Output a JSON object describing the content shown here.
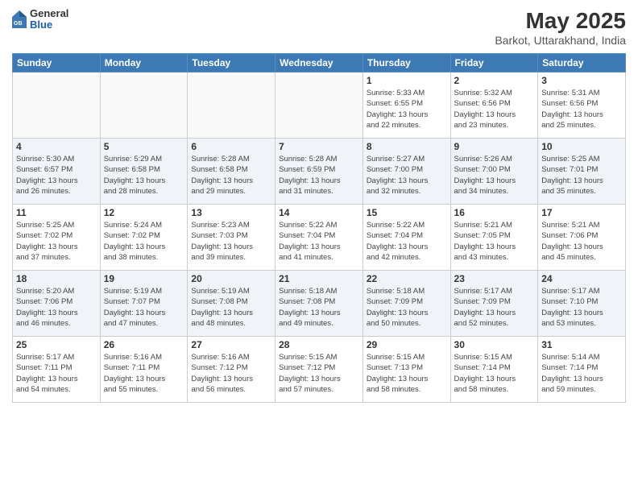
{
  "logo": {
    "general": "General",
    "blue": "Blue"
  },
  "header": {
    "title": "May 2025",
    "location": "Barkot, Uttarakhand, India"
  },
  "days": [
    "Sunday",
    "Monday",
    "Tuesday",
    "Wednesday",
    "Thursday",
    "Friday",
    "Saturday"
  ],
  "weeks": [
    [
      {
        "day": "",
        "info": ""
      },
      {
        "day": "",
        "info": ""
      },
      {
        "day": "",
        "info": ""
      },
      {
        "day": "",
        "info": ""
      },
      {
        "day": "1",
        "info": "Sunrise: 5:33 AM\nSunset: 6:55 PM\nDaylight: 13 hours\nand 22 minutes."
      },
      {
        "day": "2",
        "info": "Sunrise: 5:32 AM\nSunset: 6:56 PM\nDaylight: 13 hours\nand 23 minutes."
      },
      {
        "day": "3",
        "info": "Sunrise: 5:31 AM\nSunset: 6:56 PM\nDaylight: 13 hours\nand 25 minutes."
      }
    ],
    [
      {
        "day": "4",
        "info": "Sunrise: 5:30 AM\nSunset: 6:57 PM\nDaylight: 13 hours\nand 26 minutes."
      },
      {
        "day": "5",
        "info": "Sunrise: 5:29 AM\nSunset: 6:58 PM\nDaylight: 13 hours\nand 28 minutes."
      },
      {
        "day": "6",
        "info": "Sunrise: 5:28 AM\nSunset: 6:58 PM\nDaylight: 13 hours\nand 29 minutes."
      },
      {
        "day": "7",
        "info": "Sunrise: 5:28 AM\nSunset: 6:59 PM\nDaylight: 13 hours\nand 31 minutes."
      },
      {
        "day": "8",
        "info": "Sunrise: 5:27 AM\nSunset: 7:00 PM\nDaylight: 13 hours\nand 32 minutes."
      },
      {
        "day": "9",
        "info": "Sunrise: 5:26 AM\nSunset: 7:00 PM\nDaylight: 13 hours\nand 34 minutes."
      },
      {
        "day": "10",
        "info": "Sunrise: 5:25 AM\nSunset: 7:01 PM\nDaylight: 13 hours\nand 35 minutes."
      }
    ],
    [
      {
        "day": "11",
        "info": "Sunrise: 5:25 AM\nSunset: 7:02 PM\nDaylight: 13 hours\nand 37 minutes."
      },
      {
        "day": "12",
        "info": "Sunrise: 5:24 AM\nSunset: 7:02 PM\nDaylight: 13 hours\nand 38 minutes."
      },
      {
        "day": "13",
        "info": "Sunrise: 5:23 AM\nSunset: 7:03 PM\nDaylight: 13 hours\nand 39 minutes."
      },
      {
        "day": "14",
        "info": "Sunrise: 5:22 AM\nSunset: 7:04 PM\nDaylight: 13 hours\nand 41 minutes."
      },
      {
        "day": "15",
        "info": "Sunrise: 5:22 AM\nSunset: 7:04 PM\nDaylight: 13 hours\nand 42 minutes."
      },
      {
        "day": "16",
        "info": "Sunrise: 5:21 AM\nSunset: 7:05 PM\nDaylight: 13 hours\nand 43 minutes."
      },
      {
        "day": "17",
        "info": "Sunrise: 5:21 AM\nSunset: 7:06 PM\nDaylight: 13 hours\nand 45 minutes."
      }
    ],
    [
      {
        "day": "18",
        "info": "Sunrise: 5:20 AM\nSunset: 7:06 PM\nDaylight: 13 hours\nand 46 minutes."
      },
      {
        "day": "19",
        "info": "Sunrise: 5:19 AM\nSunset: 7:07 PM\nDaylight: 13 hours\nand 47 minutes."
      },
      {
        "day": "20",
        "info": "Sunrise: 5:19 AM\nSunset: 7:08 PM\nDaylight: 13 hours\nand 48 minutes."
      },
      {
        "day": "21",
        "info": "Sunrise: 5:18 AM\nSunset: 7:08 PM\nDaylight: 13 hours\nand 49 minutes."
      },
      {
        "day": "22",
        "info": "Sunrise: 5:18 AM\nSunset: 7:09 PM\nDaylight: 13 hours\nand 50 minutes."
      },
      {
        "day": "23",
        "info": "Sunrise: 5:17 AM\nSunset: 7:09 PM\nDaylight: 13 hours\nand 52 minutes."
      },
      {
        "day": "24",
        "info": "Sunrise: 5:17 AM\nSunset: 7:10 PM\nDaylight: 13 hours\nand 53 minutes."
      }
    ],
    [
      {
        "day": "25",
        "info": "Sunrise: 5:17 AM\nSunset: 7:11 PM\nDaylight: 13 hours\nand 54 minutes."
      },
      {
        "day": "26",
        "info": "Sunrise: 5:16 AM\nSunset: 7:11 PM\nDaylight: 13 hours\nand 55 minutes."
      },
      {
        "day": "27",
        "info": "Sunrise: 5:16 AM\nSunset: 7:12 PM\nDaylight: 13 hours\nand 56 minutes."
      },
      {
        "day": "28",
        "info": "Sunrise: 5:15 AM\nSunset: 7:12 PM\nDaylight: 13 hours\nand 57 minutes."
      },
      {
        "day": "29",
        "info": "Sunrise: 5:15 AM\nSunset: 7:13 PM\nDaylight: 13 hours\nand 58 minutes."
      },
      {
        "day": "30",
        "info": "Sunrise: 5:15 AM\nSunset: 7:14 PM\nDaylight: 13 hours\nand 58 minutes."
      },
      {
        "day": "31",
        "info": "Sunrise: 5:14 AM\nSunset: 7:14 PM\nDaylight: 13 hours\nand 59 minutes."
      }
    ]
  ]
}
